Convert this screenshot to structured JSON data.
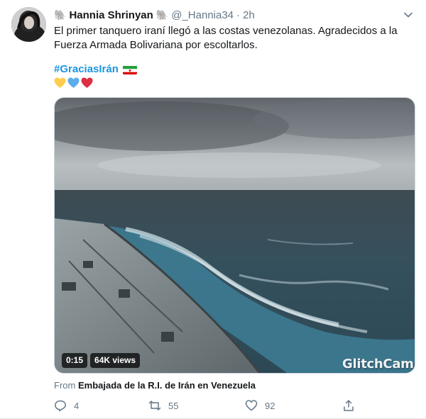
{
  "tweet": {
    "author_name": "Hannia Shrinyan",
    "author_handle": "@_Hannia34",
    "dot": "·",
    "time": "2h",
    "emoji_prefix": "🐘",
    "emoji_suffix": "🐘",
    "text": "El primer tanquero iraní llegó a las costas venezolanas. Agradecidos a la Fuerza Armada Bolivariana por escoltarlos.",
    "hashtag": "#GraciasIrán",
    "flag": "iran-flag",
    "hearts": [
      "yellow-heart",
      "blue-heart",
      "red-heart"
    ]
  },
  "media": {
    "duration": "0:15",
    "views": "64K views",
    "watermark": "GlitchCam"
  },
  "source": {
    "prefix": "From",
    "name": "Embajada de la R.I. de Irán en Venezuela"
  },
  "actions": {
    "reply_count": "4",
    "retweet_count": "55",
    "like_count": "92"
  },
  "colors": {
    "link": "#1b95e0",
    "secondary": "#657786",
    "primary_text": "#14171a"
  }
}
